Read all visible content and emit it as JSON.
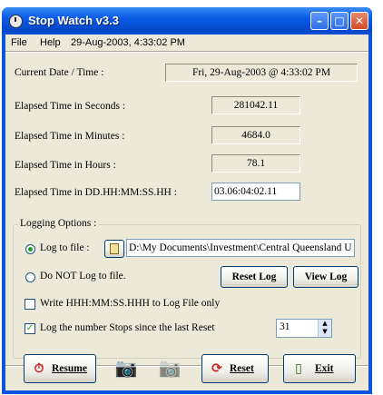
{
  "window": {
    "title": "Stop Watch v3.3"
  },
  "title_buttons": {
    "minimize": "–",
    "maximize": "□",
    "close": "✕"
  },
  "menu": {
    "file": "File",
    "help": "Help",
    "status": "29-Aug-2003, 4:33:02 PM"
  },
  "current_date": {
    "label": "Current Date / Time :",
    "value": "Fri, 29-Aug-2003 @ 4:33:02 PM"
  },
  "elapsed": {
    "seconds": {
      "label": "Elapsed Time in Seconds :",
      "value": "281042.11"
    },
    "minutes": {
      "label": "Elapsed Time in Minutes :",
      "value": "4684.0"
    },
    "hours": {
      "label": "Elapsed Time in Hours :",
      "value": "78.1"
    },
    "dhms": {
      "label": "Elapsed Time in DD.HH:MM:SS.HH :",
      "value": "03.06:04:02.11"
    }
  },
  "logging": {
    "group_title": "Logging Options :",
    "log_to_file_label": "Log to file :",
    "log_path": "D:\\My Documents\\Investment\\Central Queensland U",
    "no_log_label": "Do NOT Log to file.",
    "reset_log": "Reset Log",
    "view_log": "View Log",
    "write_hms_label": "Write HHH:MM:SS.HHH to Log File only",
    "log_stops_label": "Log the number Stops since the last Reset",
    "stops_value": "31"
  },
  "buttons": {
    "resume": "Resume",
    "reset": "Reset",
    "exit": "Exit"
  },
  "icons": {
    "app": "stopwatch-icon",
    "folder": "folder-icon",
    "camera": "camera-icon",
    "camera_disabled": "camera-disabled-icon",
    "resume": "stopwatch-resume-icon",
    "reset": "reset-icon",
    "exit": "exit-door-icon"
  }
}
